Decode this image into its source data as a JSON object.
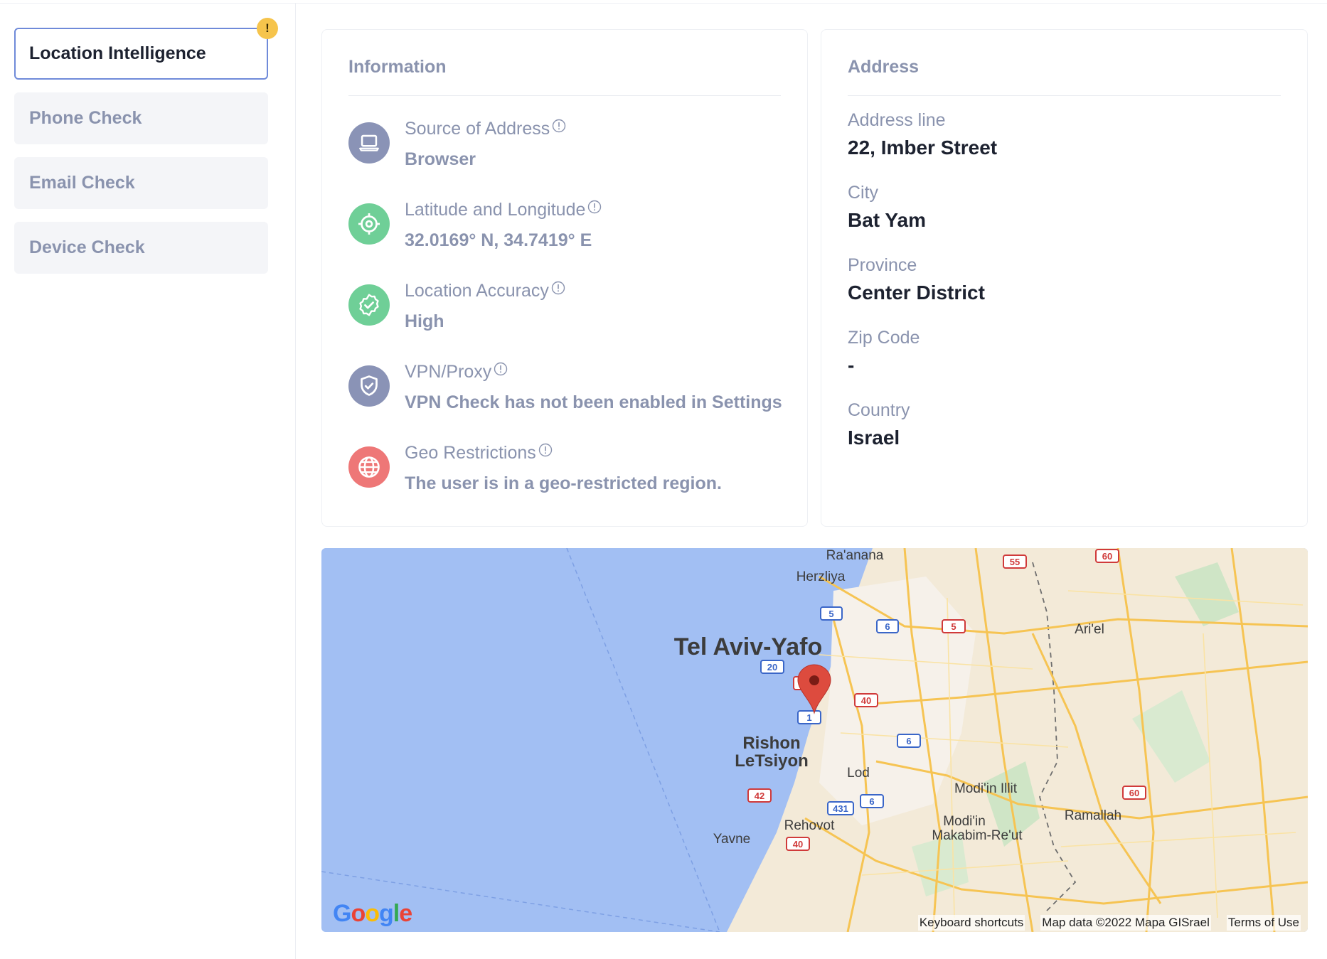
{
  "sidebar": {
    "items": [
      {
        "label": "Location Intelligence",
        "badge": "!"
      },
      {
        "label": "Phone Check"
      },
      {
        "label": "Email Check"
      },
      {
        "label": "Device Check"
      }
    ]
  },
  "information": {
    "title": "Information",
    "rows": [
      {
        "label": "Source of Address",
        "value": "Browser",
        "icon": "laptop-icon",
        "color": "#8a93b6"
      },
      {
        "label": "Latitude and Longitude",
        "value": "32.0169° N, 34.7419° E",
        "icon": "target-icon",
        "color": "#6fcf97"
      },
      {
        "label": "Location Accuracy",
        "value": "High",
        "icon": "verified-badge-icon",
        "color": "#6fcf97"
      },
      {
        "label": "VPN/Proxy",
        "value": "VPN Check has not been enabled in Settings",
        "icon": "shield-check-icon",
        "color": "#8a93b6"
      },
      {
        "label": "Geo Restrictions",
        "value": "The user is in a geo-restricted region.",
        "icon": "globe-icon",
        "color": "#ee7777"
      }
    ]
  },
  "address": {
    "title": "Address",
    "fields": [
      {
        "label": "Address line",
        "value": "22, Imber Street"
      },
      {
        "label": "City",
        "value": "Bat Yam"
      },
      {
        "label": "Province",
        "value": "Center District"
      },
      {
        "label": "Zip Code",
        "value": "-"
      },
      {
        "label": "Country",
        "value": "Israel"
      }
    ]
  },
  "map": {
    "cities": {
      "tel_aviv": "Tel Aviv-Yafo",
      "raanana": "Ra'anana",
      "herzliya": "Herzliya",
      "rishon1": "Rishon",
      "rishon2": "LeTsiyon",
      "lod": "Lod",
      "rehovot": "Rehovot",
      "yavne": "Yavne",
      "modiin_illit": "Modi'in Illit",
      "modiin1": "Modi'in",
      "modiin2": "Makabim-Re'ut",
      "ramallah": "Ramallah",
      "ariel": "Ari'el"
    },
    "route_shields": {
      "r60a": "60",
      "r55": "55",
      "r5a": "5",
      "r6a": "6",
      "r5b": "5",
      "r20": "20",
      "r4": "4",
      "r40a": "40",
      "r1": "1",
      "r6b": "6",
      "r42": "42",
      "r431": "431",
      "r6c": "6",
      "r40b": "40",
      "r60b": "60"
    },
    "footer": {
      "shortcuts": "Keyboard shortcuts",
      "data": "Map data ©2022 Mapa GISrael",
      "terms": "Terms of Use"
    },
    "logo": [
      "G",
      "o",
      "o",
      "g",
      "l",
      "e"
    ]
  },
  "colors": {
    "accent": "#6f8ad9",
    "muted_text": "#8a93ae",
    "badge": "#f6c44c",
    "water": "#a2bff3",
    "land": "#f3ead8",
    "pin": "#dd4b3e"
  }
}
